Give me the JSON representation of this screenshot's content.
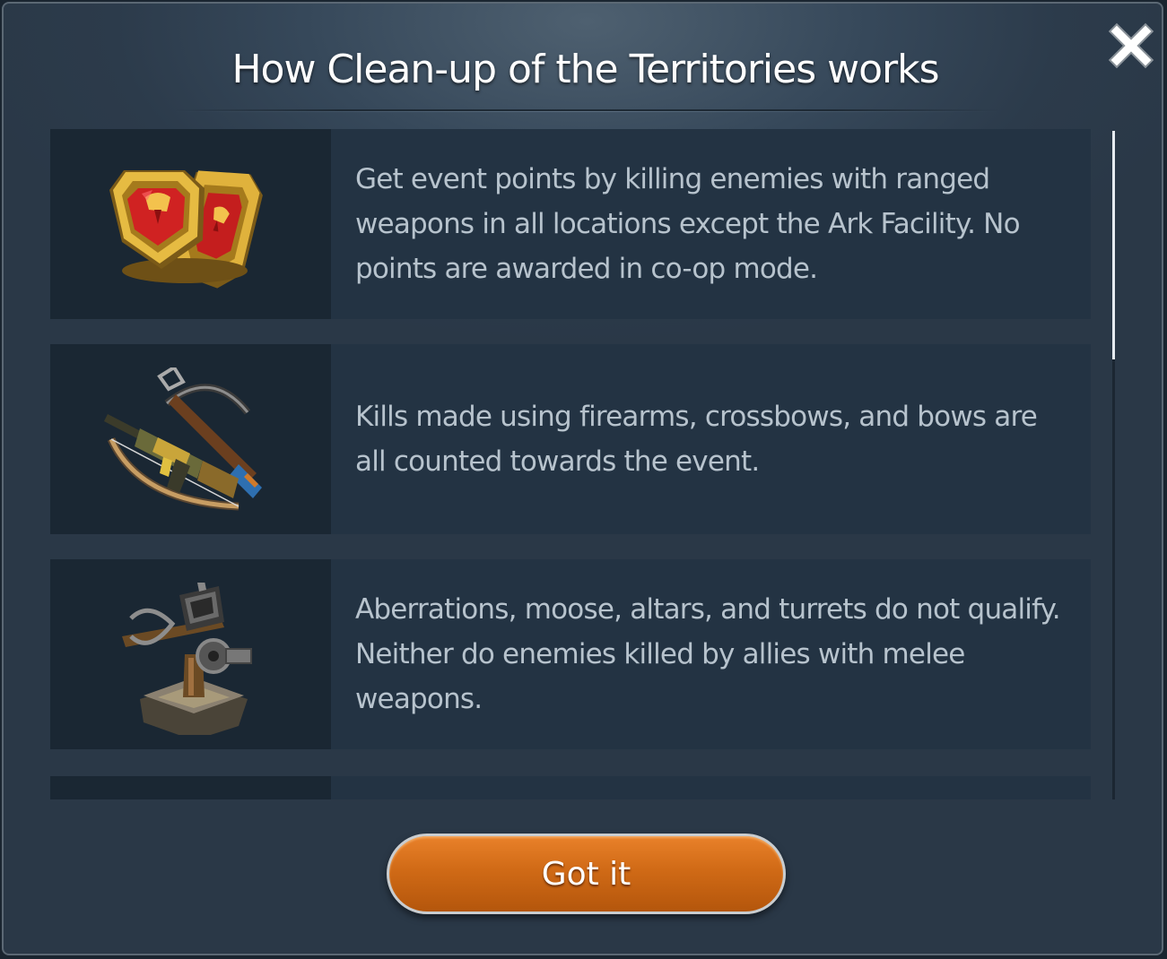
{
  "dialog": {
    "title": "How Clean-up of the Territories works",
    "close_icon": "close-icon",
    "button_label": "Got it",
    "colors": {
      "background": "#2c3b4b",
      "row": "#233343",
      "icon_cell": "#1a2733",
      "text": "#b7c3cd",
      "button": "#d06a16"
    }
  },
  "rules": [
    {
      "icon": "event-tokens-icon",
      "text": "Get event points by killing enemies with ranged weapons in all locations except the Ark Facility. No points are awarded in co-op mode."
    },
    {
      "icon": "ranged-weapons-icon",
      "text": "Kills made using firearms, crossbows, and bows are all counted towards the event."
    },
    {
      "icon": "turret-icon",
      "text": "Aberrations, moose, altars, and turrets do not qualify. Neither do enemies killed by allies with melee weapons."
    }
  ]
}
